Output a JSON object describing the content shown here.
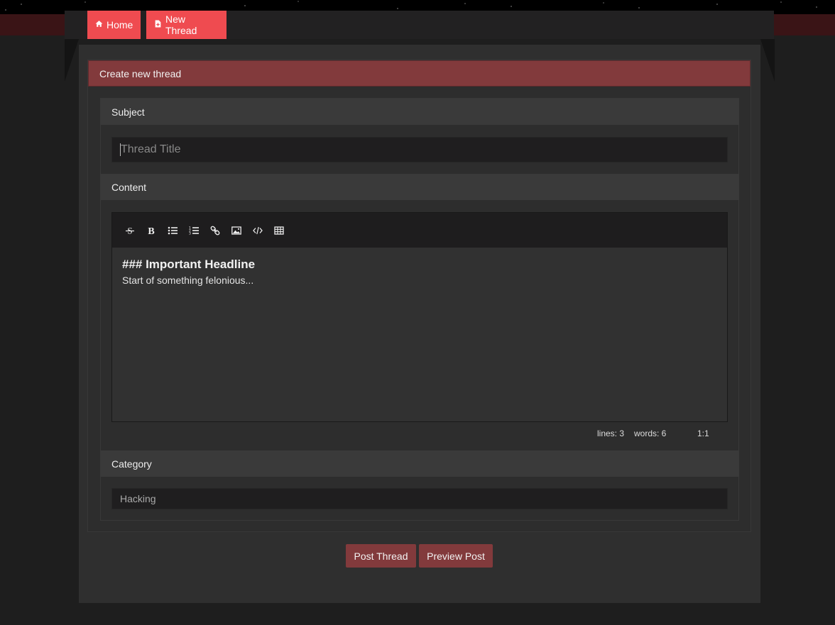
{
  "nav": {
    "home_label": "Home",
    "home_icon": "home-icon",
    "new_thread_label": "New Thread",
    "new_thread_icon": "new-file-icon"
  },
  "form": {
    "header": "Create new thread",
    "subject": {
      "label": "Subject",
      "placeholder": "Thread Title",
      "value": ""
    },
    "content": {
      "label": "Content",
      "toolbar": [
        "strikethrough-icon",
        "bold-icon",
        "bullet-list-icon",
        "numbered-list-icon",
        "link-icon",
        "image-icon",
        "code-icon",
        "table-icon"
      ],
      "heading_line": "### Important Headline",
      "body_line": "Start of something felonious...",
      "status": {
        "lines": "lines: 3",
        "words": "words: 6",
        "cursor": "1:1"
      }
    },
    "category": {
      "label": "Category",
      "selected": "Hacking"
    }
  },
  "actions": {
    "post_label": "Post Thread",
    "preview_label": "Preview Post"
  },
  "colors": {
    "accent": "#ef4b50",
    "dark_red": "#823a3c",
    "panel": "#2f2f2f"
  }
}
